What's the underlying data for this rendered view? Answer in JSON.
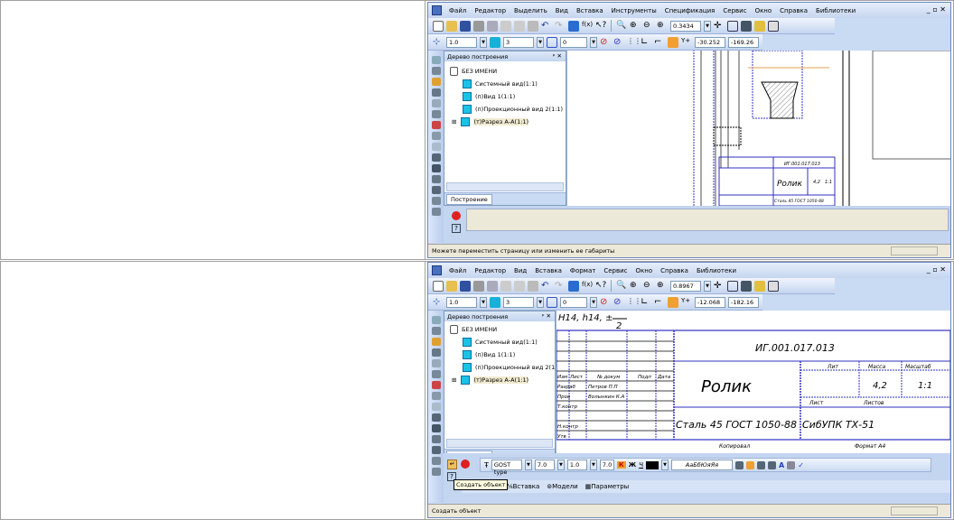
{
  "screens": [
    {
      "menu": [
        "Файл",
        "Редактор",
        "Выделить",
        "Вид",
        "Вставка",
        "Инструменты",
        "Спецификация",
        "Сервис",
        "Окно",
        "Справка",
        "Библиотеки"
      ],
      "window_controls": "_ ▫ ✕",
      "zoom": "0.3434",
      "line_step": "1.0",
      "style_num": "3",
      "layer": "0",
      "coord_x": "-30.252",
      "coord_y": "-169.26",
      "tree_title": "Дерево построения",
      "tree_items": [
        "БЕЗ ИМЕНИ",
        "Системный вид(1:1)",
        "(п)Вид 1(1:1)",
        "(п)Проекционный вид 2(1:1)",
        "(т)Разрез А-А(1:1)"
      ],
      "tree_tab": "Построение",
      "drawing": {
        "designation": "ИГ.001.017.013",
        "name": "Ролик",
        "material": "Сталь 45  ГОСТ 1050-88",
        "mass": "4,2",
        "scale": "1:1"
      },
      "status": "Можете переместить страницу или изменить ее габариты"
    },
    {
      "menu": [
        "Файл",
        "Редактор",
        "Вид",
        "Вставка",
        "Формат",
        "Сервис",
        "Окно",
        "Справка",
        "Библиотеки"
      ],
      "window_controls": "_ ▫ ✕",
      "zoom": "0.8967",
      "line_step": "1.0",
      "style_num": "3",
      "layer": "0",
      "coord_x": "-12.068",
      "coord_y": "-182.16",
      "tree_title": "Дерево построения",
      "tree_items": [
        "БЕЗ ИМЕНИ",
        "Системный вид(1:1)",
        "(п)Вид 1(1:1)",
        "(п)Проекционный вид 2(1:1)",
        "(т)Разрез А-А(1:1)"
      ],
      "tree_tab": "Построение",
      "drawing": {
        "tolerance_note": "Н14, h14, ±",
        "tolerance_frac": "2",
        "designation": "ИГ.001.017.013",
        "name": "Ролик",
        "material": "Сталь 45  ГОСТ 1050-88",
        "org": "СибУПК  ТХ-51",
        "lit": "Лит",
        "mass_label": "Масса",
        "scale_label": "Масштаб",
        "mass": "4,2",
        "scale": "1:1",
        "sheet": "Лист",
        "sheets": "Листов",
        "col_headers": [
          "Изм",
          "Лист",
          "№ докум",
          "Подп",
          "Дата"
        ],
        "rows": [
          "Разраб",
          "Пров",
          "Т.контр",
          "Н.контр",
          "Утв"
        ],
        "developer": "Петров П.П",
        "checker": "Волынкин К.А",
        "copied": "Копировал",
        "format": "Формат   А4"
      },
      "text_toolbar": {
        "font": "GOST type",
        "height": "7.0",
        "width": "1.0",
        "step": "7.0",
        "bold": "К",
        "italic": "Ж",
        "underline": "Ч",
        "preview": "АаБбЮяЯя"
      },
      "tooltip": "Создать объект",
      "bottom_tabs": [
        "Вставка",
        "Модели",
        "Параметры"
      ],
      "status": "Создать объект"
    }
  ]
}
